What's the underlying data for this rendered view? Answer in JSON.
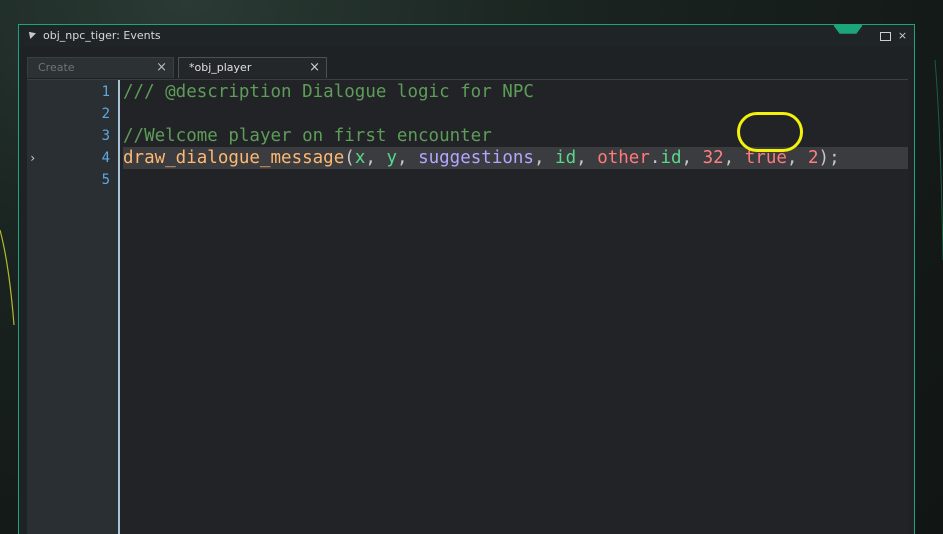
{
  "window": {
    "title": "obj_npc_tiger: Events",
    "minimize_icon": "pin-icon",
    "maximize_icon": "maximize-icon",
    "close_glyph": "×"
  },
  "tabs": [
    {
      "label": "Create",
      "close": "×",
      "active": false
    },
    {
      "label": "*obj_player",
      "close": "×",
      "active": true
    }
  ],
  "editor": {
    "line_numbers": [
      "1",
      "2",
      "3",
      "4",
      "5"
    ],
    "current_line_marker": "›",
    "lines": [
      {
        "tokens": [
          {
            "t": "/// @description Dialogue logic for NPC",
            "k": "comment"
          }
        ]
      },
      {
        "tokens": []
      },
      {
        "tokens": [
          {
            "t": "//Welcome player on first encounter",
            "k": "comment"
          }
        ]
      },
      {
        "tokens": [
          {
            "t": "draw_dialogue_message",
            "k": "func"
          },
          {
            "t": "(",
            "k": "punct"
          },
          {
            "t": "x",
            "k": "builtin"
          },
          {
            "t": ", ",
            "k": "punct"
          },
          {
            "t": "y",
            "k": "builtin"
          },
          {
            "t": ", ",
            "k": "punct"
          },
          {
            "t": "suggestions",
            "k": "var"
          },
          {
            "t": ", ",
            "k": "punct"
          },
          {
            "t": "id",
            "k": "builtin"
          },
          {
            "t": ", ",
            "k": "punct"
          },
          {
            "t": "other",
            "k": "keyword"
          },
          {
            "t": ".",
            "k": "punct"
          },
          {
            "t": "id",
            "k": "builtin"
          },
          {
            "t": ", ",
            "k": "punct"
          },
          {
            "t": "32",
            "k": "num"
          },
          {
            "t": ", ",
            "k": "punct"
          },
          {
            "t": "true",
            "k": "keyword"
          },
          {
            "t": ", ",
            "k": "punct"
          },
          {
            "t": "2",
            "k": "num"
          },
          {
            "t": ");",
            "k": "punct"
          }
        ],
        "active": true
      },
      {
        "tokens": []
      }
    ]
  },
  "colors": {
    "window_border": "#1aa57a",
    "highlight_ring": "#f2f20a",
    "line_number": "#5fa8e0"
  }
}
